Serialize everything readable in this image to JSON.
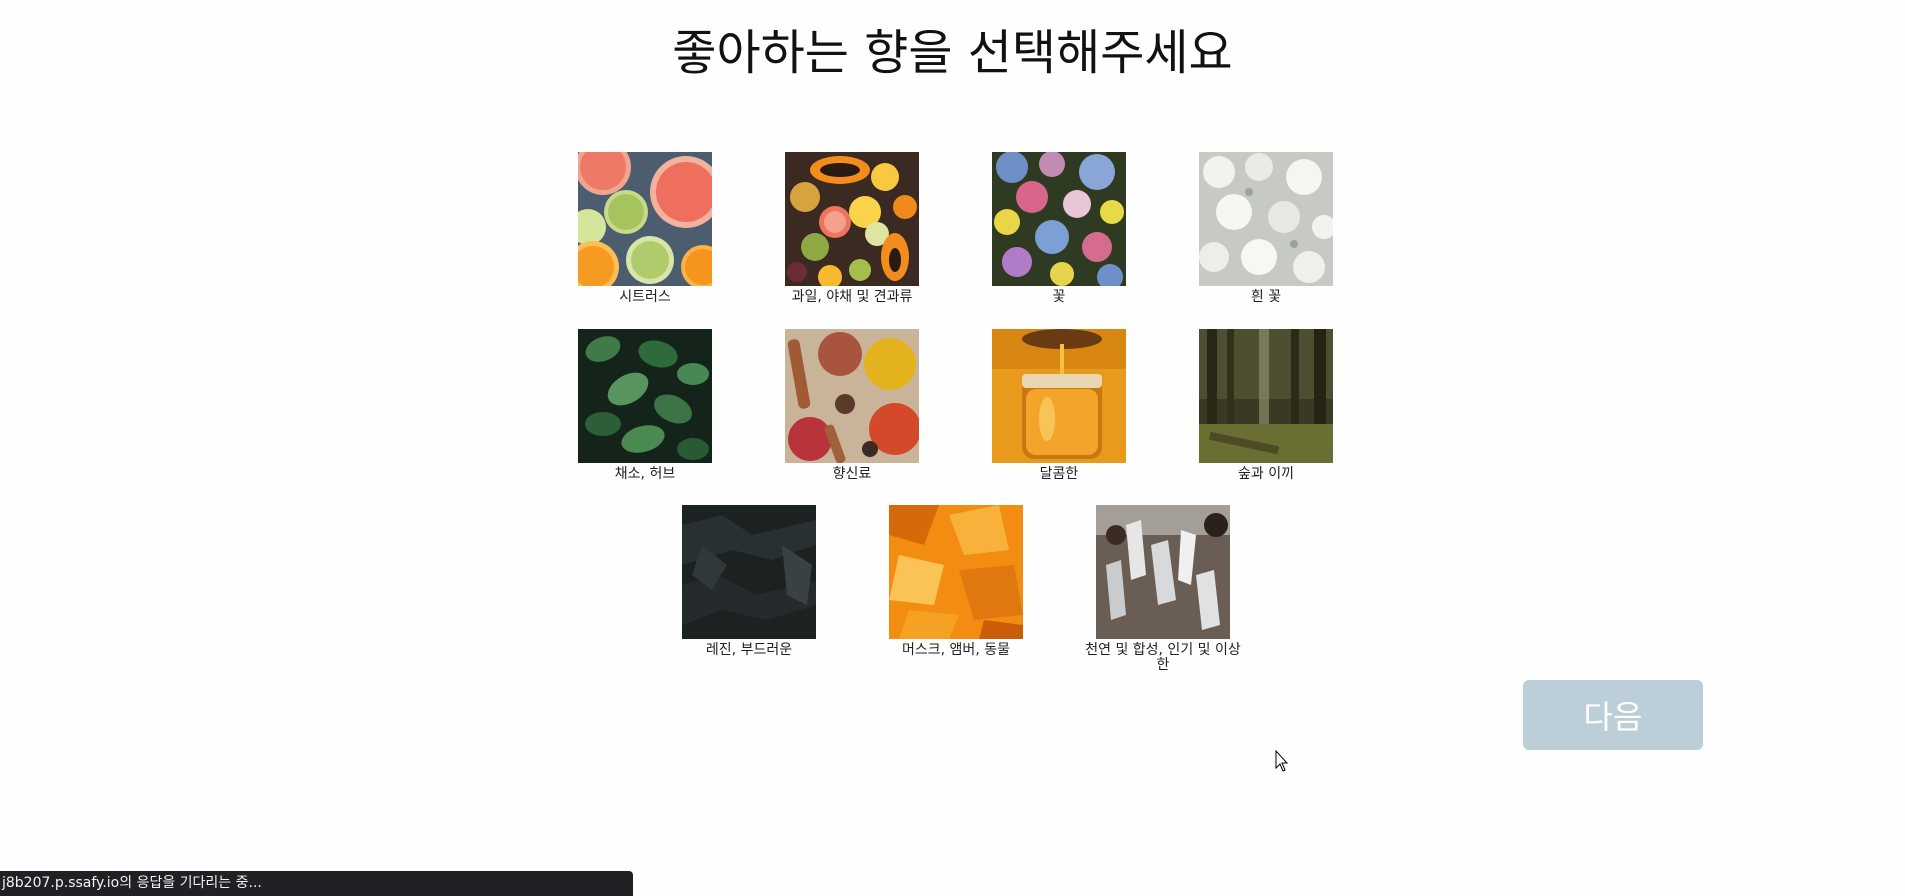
{
  "header": {
    "title": "좋아하는 향을 선택해주세요"
  },
  "scents": [
    {
      "label": "시트러스",
      "image": "citrus-slices-image"
    },
    {
      "label": "과일, 야채 및 견과류",
      "image": "fruits-image"
    },
    {
      "label": "꽃",
      "image": "flowers-image"
    },
    {
      "label": "흰 꽃",
      "image": "white-flowers-image"
    },
    {
      "label": "채소, 허브",
      "image": "mint-herb-image"
    },
    {
      "label": "향신료",
      "image": "spices-image"
    },
    {
      "label": "달콤한",
      "image": "honey-jar-image"
    },
    {
      "label": "숲과 이끼",
      "image": "forest-moss-image"
    },
    {
      "label": "레진, 부드러운",
      "image": "dark-resin-image"
    },
    {
      "label": "머스크, 앰버, 동물",
      "image": "amber-crystal-image"
    },
    {
      "label": "천연 및 합성, 인기 및 이상한",
      "image": "quartz-crystal-image"
    }
  ],
  "footer": {
    "next_label": "다음"
  },
  "status_bar": {
    "text": "j8b207.p.ssafy.io의 응답을 기다리는 중..."
  },
  "colors": {
    "background": "#fefefe",
    "next_button": "#bccfd8",
    "status_bar": "#202124"
  }
}
